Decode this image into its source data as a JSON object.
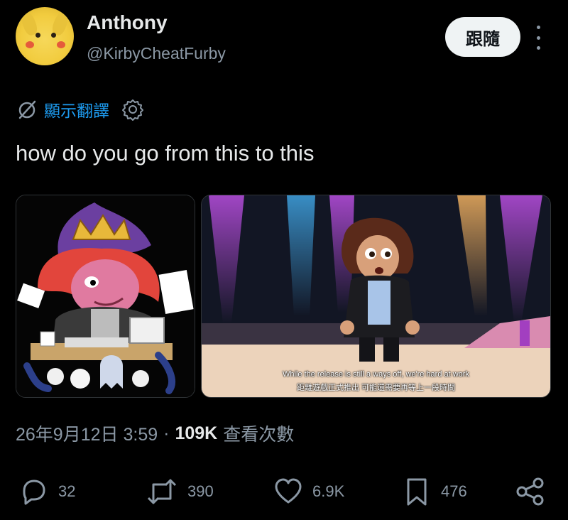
{
  "user": {
    "name": "Anthony",
    "handle": "@KirbyCheatFurby",
    "avatar_icon": "pikachu-avatar"
  },
  "header": {
    "follow_label": "跟隨",
    "more_icon": "more-vertical-icon"
  },
  "translate": {
    "label": "顯示翻譯",
    "globe_icon": "globe-icon",
    "settings_icon": "gear-icon"
  },
  "tweet": {
    "text": "how do you go from this to this"
  },
  "media": [
    {
      "kind": "image",
      "description_icon": "cartoon-hacker-image"
    },
    {
      "kind": "video-still",
      "subtitle_en": "While the release is still a ways off, we're hard at work",
      "subtitle_zh": "距離遊戲正式推出 可能還需要再等上一段時間"
    }
  ],
  "meta": {
    "datetime": "26年9月12日 3:59",
    "separator": "·",
    "views": "109K",
    "views_label": "查看次數"
  },
  "actions": {
    "replies": "32",
    "reposts": "390",
    "likes": "6.9K",
    "bookmarks": "476"
  },
  "colors": {
    "background": "#000000",
    "text": "#e7e9ea",
    "secondary": "#8b98a5",
    "link": "#1d9bf0",
    "follow_bg": "#eff3f4"
  }
}
